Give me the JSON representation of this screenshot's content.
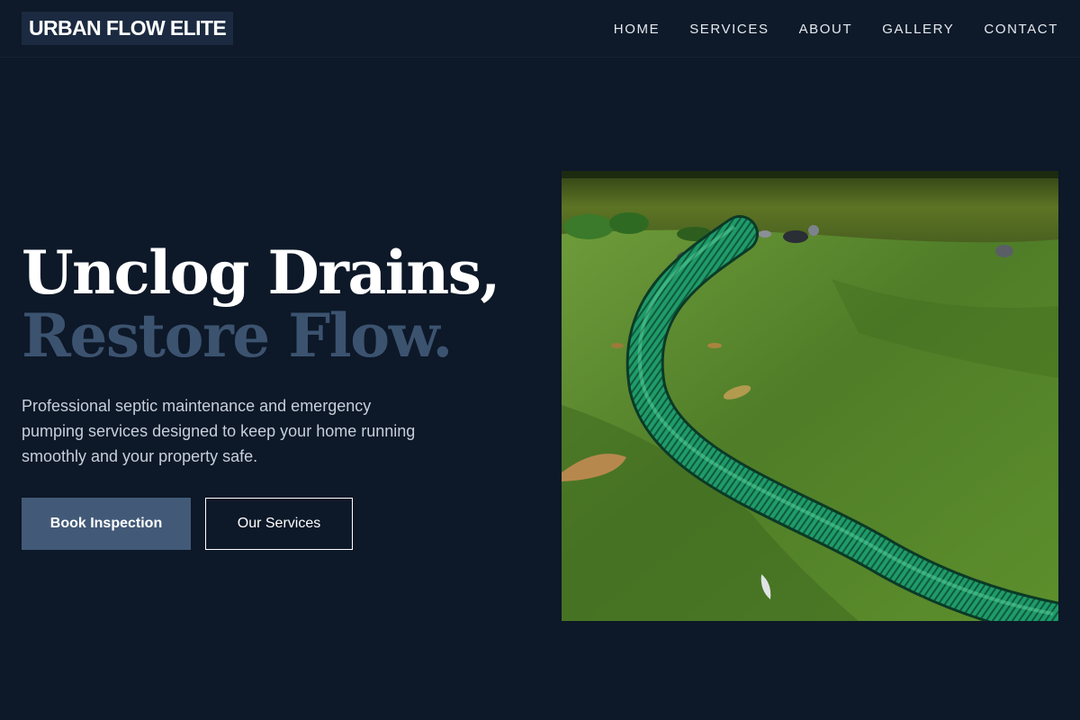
{
  "brand": {
    "name": "URBAN FLOW ELITE"
  },
  "nav": {
    "items": [
      {
        "label": "HOME"
      },
      {
        "label": "SERVICES"
      },
      {
        "label": "ABOUT"
      },
      {
        "label": "GALLERY"
      },
      {
        "label": "CONTACT"
      }
    ]
  },
  "hero": {
    "title_line1": "Unclog Drains,",
    "title_line2": "Restore Flow.",
    "description": "Professional septic maintenance and emergency pumping services designed to keep your home running smoothly and your property safe.",
    "primary_button": "Book Inspection",
    "secondary_button": "Our Services",
    "image_subject": "green-septic-hose-on-lawn-photo"
  },
  "colors": {
    "background": "#0d1828",
    "header": "#0e1a29",
    "logo_bg": "#1b2a40",
    "accent": "#425a78",
    "title_muted": "#3c5370",
    "body_text": "#c6cfdb"
  }
}
